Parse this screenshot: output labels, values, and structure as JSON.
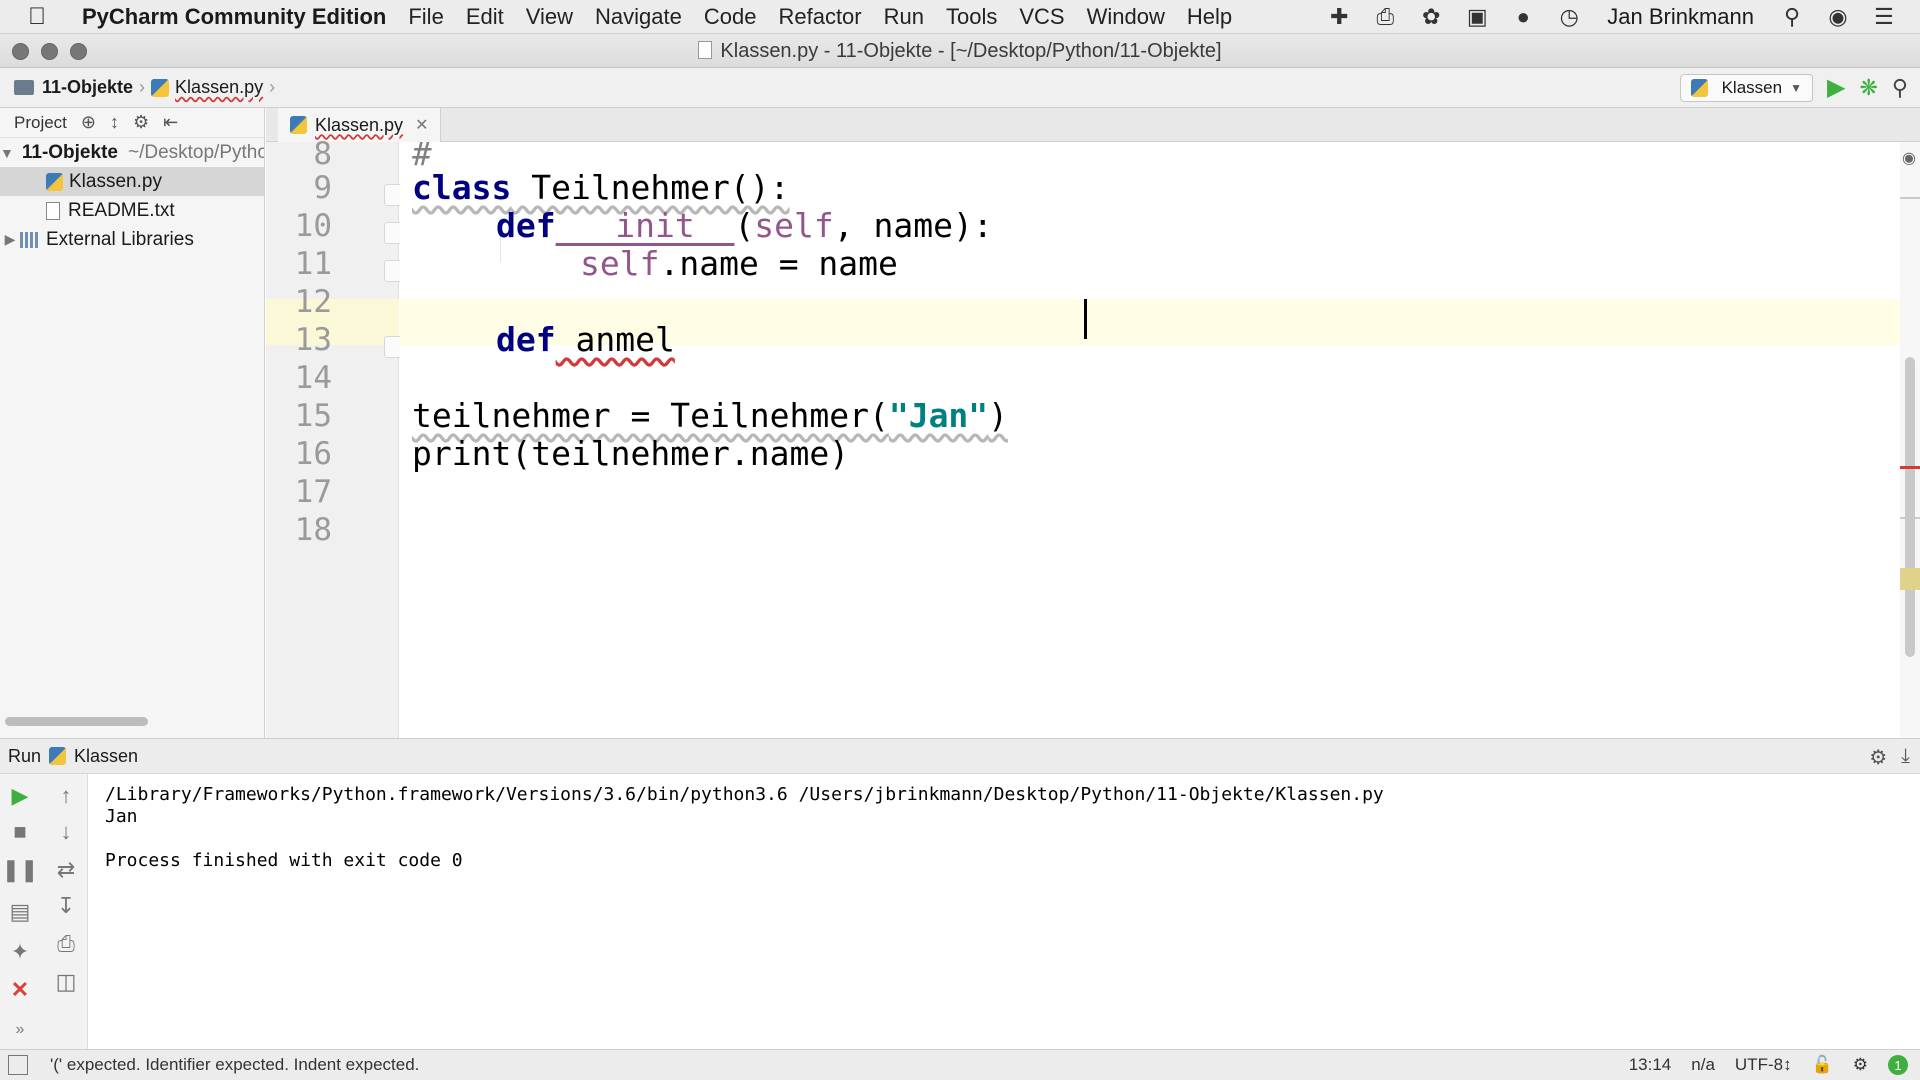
{
  "menubar": {
    "apple": "",
    "app_name": "PyCharm Community Edition",
    "items": [
      "File",
      "Edit",
      "View",
      "Navigate",
      "Code",
      "Refactor",
      "Run",
      "Tools",
      "VCS",
      "Window",
      "Help"
    ],
    "user": "Jan Brinkmann",
    "status_icons": [
      "plus-cross-icon",
      "printer-icon",
      "leaf-icon",
      "camera-icon",
      "chat-icon",
      "history-icon",
      "search-icon",
      "siri-icon",
      "list-icon"
    ]
  },
  "window": {
    "title": "Klassen.py - 11-Objekte - [~/Desktop/Python/11-Objekte]"
  },
  "navbar": {
    "project": "11-Objekte",
    "file": "Klassen.py",
    "run_config": "Klassen"
  },
  "project": {
    "header_label": "Project",
    "tree": [
      {
        "label": "11-Objekte",
        "path": "~/Desktop/Python/11-Objekte"
      },
      {
        "label": "Klassen.py"
      },
      {
        "label": "README.txt"
      },
      {
        "label": "External Libraries"
      }
    ]
  },
  "editor": {
    "tab": "Klassen.py",
    "lines": [
      {
        "no": "8"
      },
      {
        "no": "9"
      },
      {
        "no": "10"
      },
      {
        "no": "11"
      },
      {
        "no": "12"
      },
      {
        "no": "13"
      },
      {
        "no": "14"
      },
      {
        "no": "15"
      },
      {
        "no": "16"
      },
      {
        "no": "17"
      },
      {
        "no": "18"
      }
    ],
    "code": {
      "l8": "#",
      "l9_kw": "class",
      "l9_rest": " Teilnehmer():",
      "l10_kw": "def",
      "l10_name": " __init__",
      "l10_paren": "(",
      "l10_self": "self",
      "l10_rest": ", name):",
      "l11_self": "self",
      "l11_rest": ".name = name",
      "l13_kw": "def",
      "l13_rest": " anmel",
      "l15_pre": "teilnehmer = Teilnehmer(",
      "l15_str": "\"Jan\"",
      "l15_post": ")",
      "l16": "print(teilnehmer.name)"
    }
  },
  "run": {
    "label": "Run",
    "config": "Klassen",
    "console": [
      "/Library/Frameworks/Python.framework/Versions/3.6/bin/python3.6 /Users/jbrinkmann/Desktop/Python/11-Objekte/Klassen.py",
      "Jan",
      "",
      "Process finished with exit code 0"
    ]
  },
  "statusbar": {
    "message": "'(' expected. Identifier expected. Indent expected.",
    "position": "13:14",
    "line_sep": "n/a",
    "encoding": "UTF-8↕",
    "badge": "1"
  }
}
